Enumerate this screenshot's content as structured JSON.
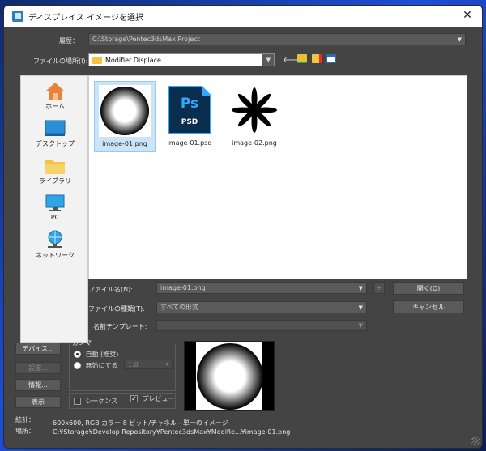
{
  "window": {
    "title": "ディスプレイス イメージを選択",
    "close_label": "✕"
  },
  "history": {
    "label": "履歴：",
    "value": "C:\\Storage\\Pentec3dsMax Project"
  },
  "location": {
    "label": "ファイルの場所(I):",
    "value": "Modifier Displace"
  },
  "sidebar": {
    "items": [
      {
        "label": "ホーム",
        "icon": "home-icon"
      },
      {
        "label": "デスクトップ",
        "icon": "desktop-icon"
      },
      {
        "label": "ライブラリ",
        "icon": "library-icon"
      },
      {
        "label": "PC",
        "icon": "pc-icon"
      },
      {
        "label": "ネットワーク",
        "icon": "network-icon"
      }
    ]
  },
  "files": [
    {
      "name": "image-01.png",
      "selected": true
    },
    {
      "name": "image-01.psd",
      "selected": false,
      "ps_text": "Ps",
      "psd_text": "PSD"
    },
    {
      "name": "image-02.png",
      "selected": false
    }
  ],
  "filename": {
    "label": "ファイル名(N):",
    "value": "image-01.png",
    "plus_label": "+",
    "open_label": "開く(O)"
  },
  "filetype": {
    "label": "ファイルの種類(T):",
    "value": "すべての形式",
    "cancel_label": "キャンセル"
  },
  "template": {
    "label": "名前テンプレート:"
  },
  "left_buttons": {
    "devices": "デバイス...",
    "setup": "設定...",
    "info": "情報...",
    "view": "表示"
  },
  "gamma": {
    "title": "ガンマ",
    "auto_label": "自動 (推奨)",
    "override_label": "無効にする",
    "override_value": "1.0"
  },
  "options": {
    "sequence_label": "シーケンス",
    "preview_label": "プレビュー",
    "preview_checked": "✓"
  },
  "stats": {
    "stats_label": "統計：",
    "stats_value": "600x600, RGB カラー 8 ビット/チャネル - 単一のイメージ",
    "location_label": "場所：",
    "location_value": "C:¥Storage¥Develop Repository¥Pentec3dsMax¥Modifie...¥image-01.png"
  },
  "colors": {
    "dialog_bg": "#444444",
    "selection": "#cce4f7",
    "ps_blue": "#0b2e4f",
    "ps_accent": "#31a8ff"
  }
}
